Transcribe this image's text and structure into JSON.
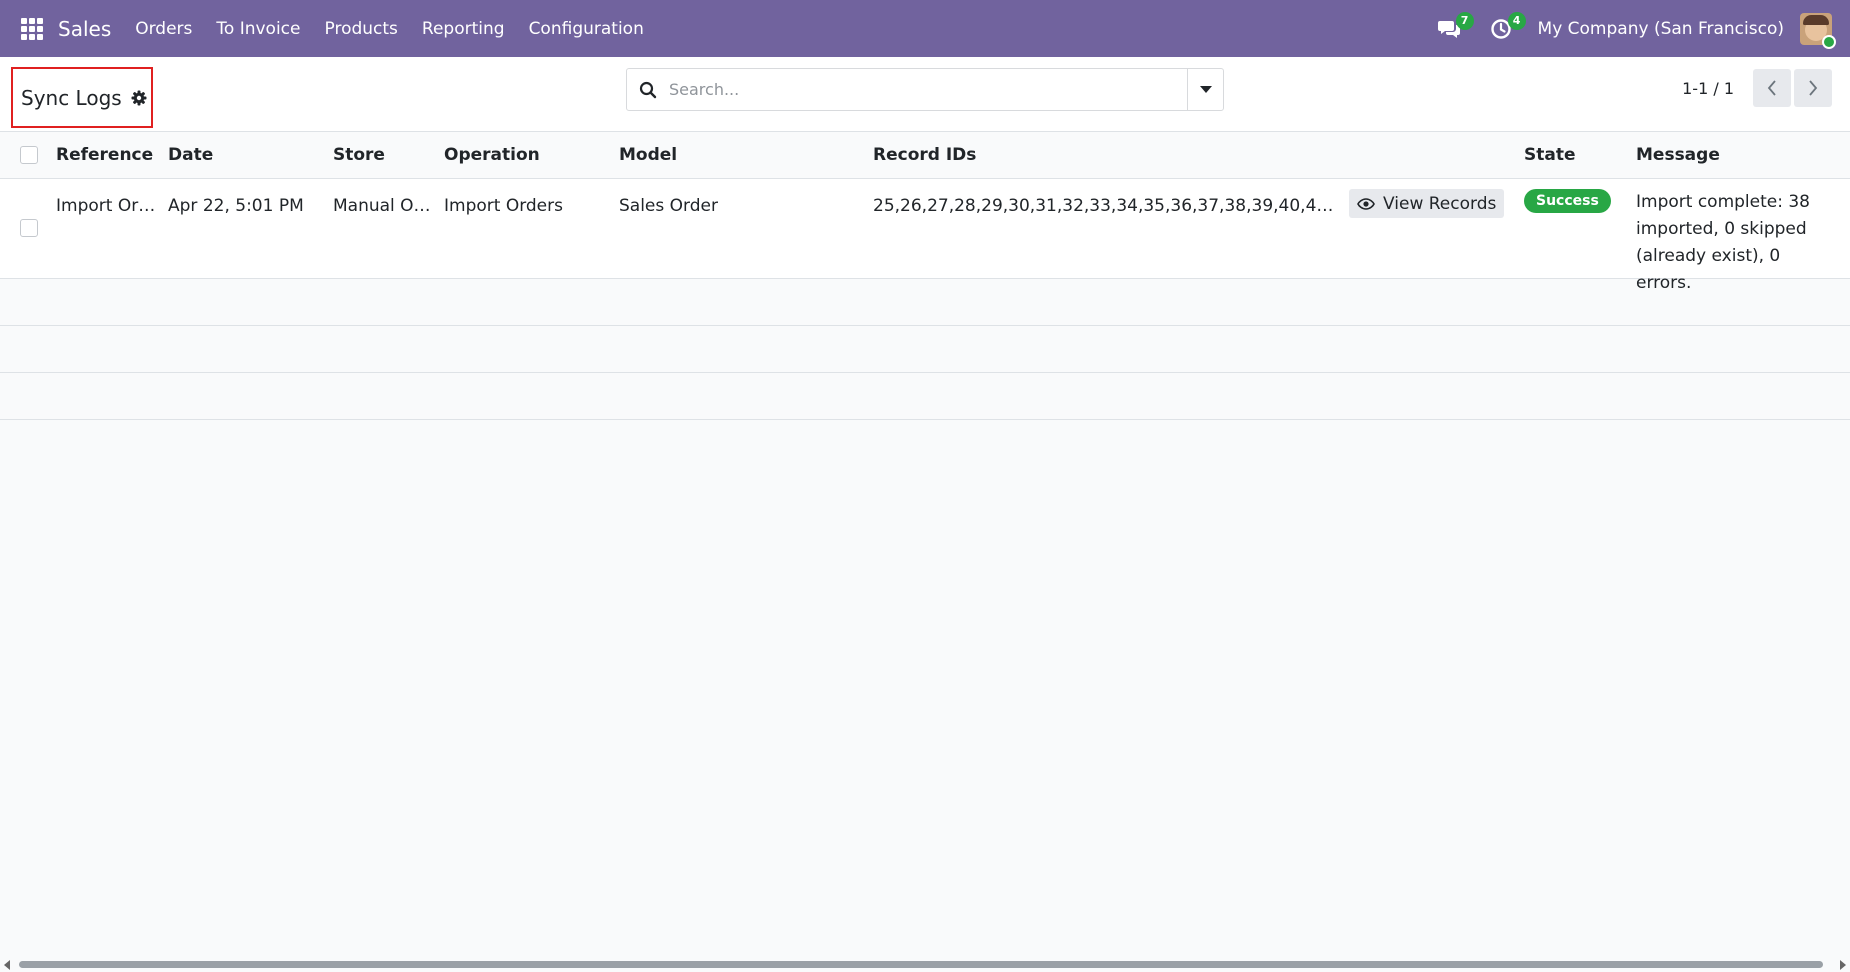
{
  "navbar": {
    "app_name": "Sales",
    "menu": [
      "Orders",
      "To Invoice",
      "Products",
      "Reporting",
      "Configuration"
    ],
    "messages_count": "7",
    "activities_count": "4",
    "company": "My Company (San Francisco)",
    "bg_color": "#71639e"
  },
  "control_panel": {
    "title": "Sync Logs",
    "search_placeholder": "Search...",
    "pager": "1-1 / 1"
  },
  "table": {
    "columns": [
      "Reference",
      "Date",
      "Store",
      "Operation",
      "Model",
      "Record IDs",
      "State",
      "Message"
    ],
    "rows": [
      {
        "reference": "Import Or…",
        "date": "Apr 22, 5:01 PM",
        "store": "Manual O…",
        "operation": "Import Orders",
        "model": "Sales Order",
        "record_ids": "25,26,27,28,29,30,31,32,33,34,35,36,37,38,39,40,41,42,4…",
        "view_button": "View Records",
        "state": "Success",
        "message": "Import complete: 38 imported, 0 skipped (already exist), 0 errors."
      }
    ]
  },
  "colors": {
    "success": "#28a745",
    "highlight_border": "#e02020"
  }
}
